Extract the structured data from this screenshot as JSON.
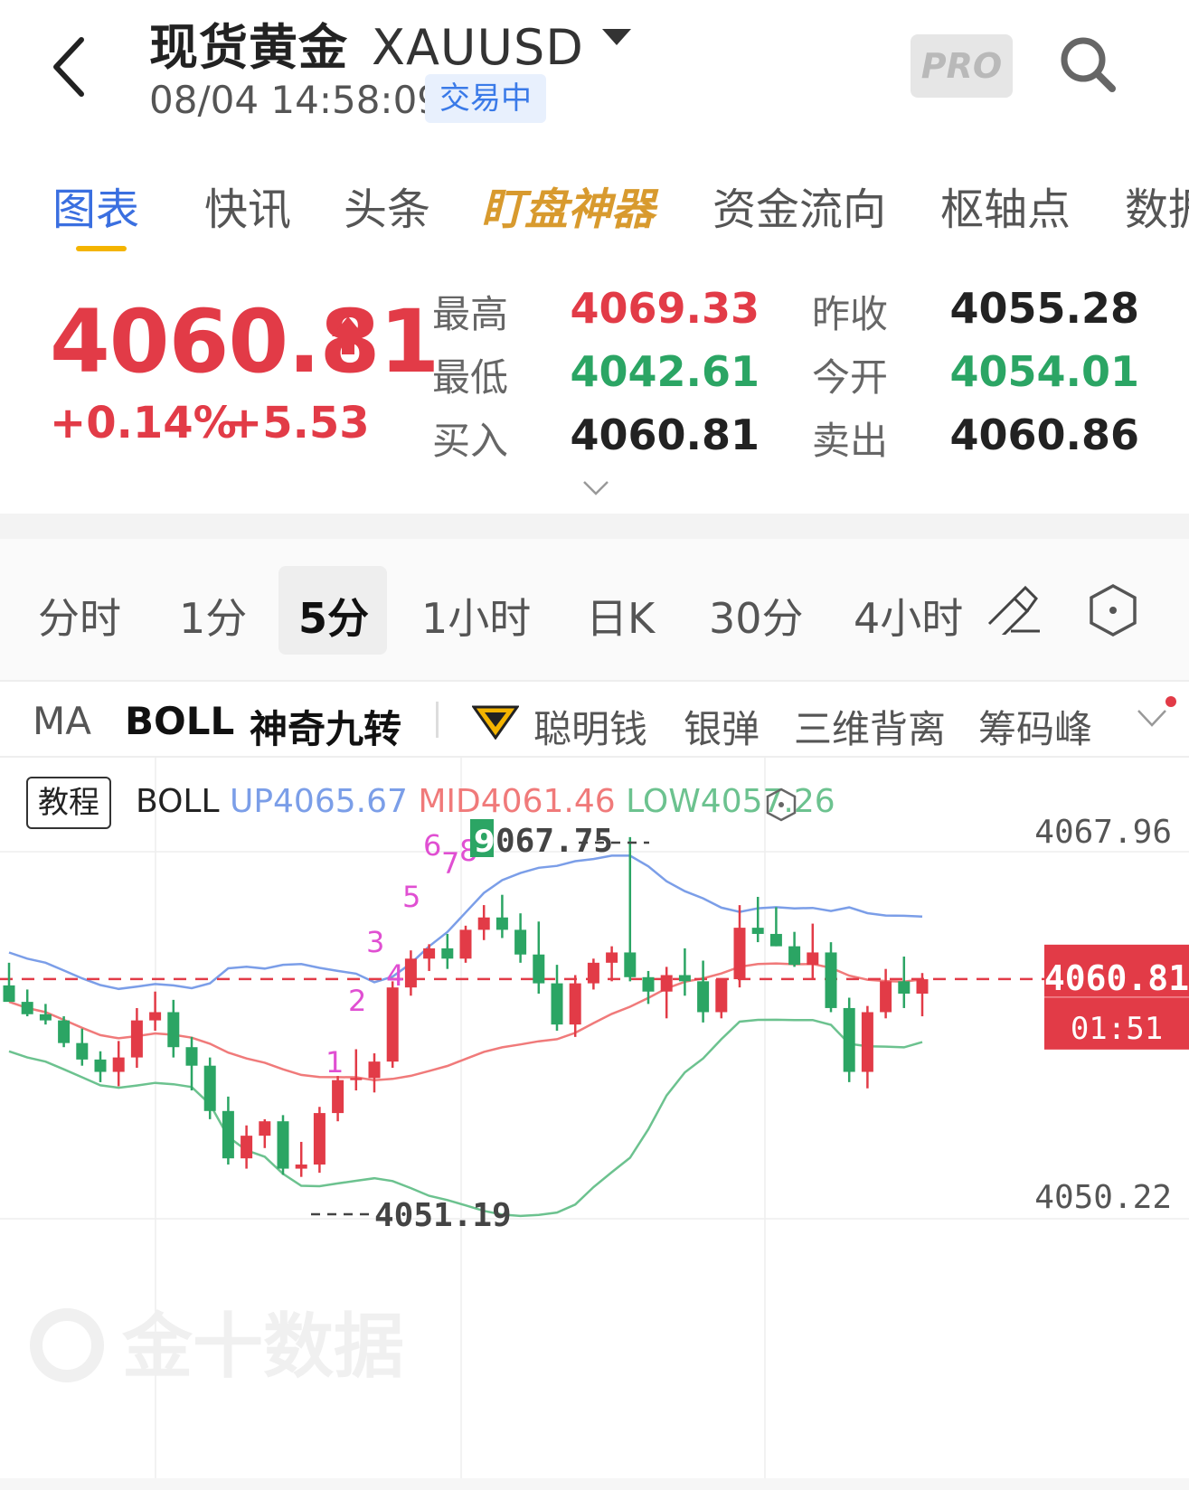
{
  "header": {
    "title": "现货黄金",
    "symbol": "XAUUSD",
    "datetime": "08/04 14:58:09",
    "status": "交易中",
    "pro_label": "PRO"
  },
  "main_tabs": [
    {
      "label": "图表"
    },
    {
      "label": "快讯"
    },
    {
      "label": "头条"
    },
    {
      "label": "盯盘神器"
    },
    {
      "label": "资金流向"
    },
    {
      "label": "枢轴点"
    },
    {
      "label": "数据"
    }
  ],
  "quote": {
    "price": "4060.81",
    "change_pct": "+0.14%",
    "change": "+5.53",
    "high_label": "最高",
    "high": "4069.33",
    "low_label": "最低",
    "low": "4042.61",
    "bid_label": "买入",
    "bid": "4060.81",
    "prev_close_label": "昨收",
    "prev_close": "4055.28",
    "open_label": "今开",
    "open": "4054.01",
    "ask_label": "卖出",
    "ask": "4060.86"
  },
  "period_tabs": [
    {
      "label": "分时"
    },
    {
      "label": "1分"
    },
    {
      "label": "5分"
    },
    {
      "label": "1小时"
    },
    {
      "label": "日K"
    },
    {
      "label": "30分"
    },
    {
      "label": "4小时"
    }
  ],
  "selected_period": "5分",
  "indicator_tabs": [
    {
      "label": "MA"
    },
    {
      "label": "BOLL"
    },
    {
      "label": "神奇九转"
    },
    {
      "label": "聪明钱"
    },
    {
      "label": "银弹"
    },
    {
      "label": "三维背离"
    },
    {
      "label": "筹码峰"
    }
  ],
  "chart_header": {
    "tutorial": "教程",
    "boll_name": "BOLL",
    "up": "UP4065.67",
    "mid": "MID4061.46",
    "low": "LOW4057.26"
  },
  "colors": {
    "up": "#e23b47",
    "down": "#2ba564",
    "boll_up": "#7b9ee8",
    "boll_mid": "#f07a7a",
    "boll_low": "#6cc28f",
    "accent": "#3a6fe0"
  },
  "chart_data": {
    "type": "candlestick",
    "axis_labels": [
      "4067.96",
      "4050.22"
    ],
    "current_price_tag": "4060.81",
    "countdown": "01:51",
    "high_marker": "4067.75",
    "high_marker_count": "9",
    "low_marker": "4051.19",
    "td_counts": [
      "1",
      "2",
      "3",
      "4",
      "5",
      "6",
      "7",
      "8"
    ],
    "watermark": "金十数据",
    "candles": [
      [
        4060.5,
        4061.6,
        4059.8,
        4059.7
      ],
      [
        4059.7,
        4060.3,
        4059.0,
        4059.1
      ],
      [
        4059.1,
        4059.6,
        4058.6,
        4058.8
      ],
      [
        4058.8,
        4059.0,
        4057.5,
        4057.7
      ],
      [
        4057.7,
        4058.4,
        4056.6,
        4056.9
      ],
      [
        4056.9,
        4057.3,
        4055.8,
        4056.3
      ],
      [
        4056.3,
        4057.8,
        4055.6,
        4057.0
      ],
      [
        4057.0,
        4059.4,
        4056.5,
        4058.8
      ],
      [
        4058.8,
        4060.2,
        4058.3,
        4059.2
      ],
      [
        4059.2,
        4059.8,
        4057.0,
        4057.5
      ],
      [
        4057.5,
        4058.0,
        4055.4,
        4056.6
      ],
      [
        4056.6,
        4057.0,
        4054.0,
        4054.4
      ],
      [
        4054.4,
        4055.1,
        4051.8,
        4052.1
      ],
      [
        4052.1,
        4053.7,
        4051.6,
        4053.2
      ],
      [
        4053.2,
        4054.0,
        4052.6,
        4053.9
      ],
      [
        4053.9,
        4054.2,
        4051.3,
        4051.6
      ],
      [
        4051.6,
        4052.9,
        4051.2,
        4051.8
      ],
      [
        4051.8,
        4054.6,
        4051.4,
        4054.3
      ],
      [
        4054.3,
        4056.1,
        4053.9,
        4055.9
      ],
      [
        4055.9,
        4057.4,
        4055.4,
        4056.0
      ],
      [
        4056.0,
        4057.2,
        4055.3,
        4056.8
      ],
      [
        4056.8,
        4060.7,
        4056.5,
        4060.4
      ],
      [
        4060.4,
        4062.2,
        4060.0,
        4061.8
      ],
      [
        4061.8,
        4062.5,
        4061.2,
        4062.3
      ],
      [
        4062.3,
        4063.0,
        4061.3,
        4061.8
      ],
      [
        4061.8,
        4063.4,
        4061.6,
        4063.2
      ],
      [
        4063.2,
        4064.4,
        4062.7,
        4063.8
      ],
      [
        4063.8,
        4064.9,
        4062.8,
        4063.2
      ],
      [
        4063.2,
        4064.0,
        4061.6,
        4062.0
      ],
      [
        4062.0,
        4063.6,
        4060.1,
        4060.6
      ],
      [
        4060.6,
        4061.5,
        4058.3,
        4058.6
      ],
      [
        4058.6,
        4061.0,
        4058.0,
        4060.6
      ],
      [
        4060.6,
        4061.8,
        4060.3,
        4061.6
      ],
      [
        4061.6,
        4062.4,
        4060.7,
        4062.1
      ],
      [
        4062.1,
        4067.7,
        4060.7,
        4060.9
      ],
      [
        4060.9,
        4061.2,
        4059.6,
        4060.2
      ],
      [
        4060.2,
        4061.4,
        4058.9,
        4061.0
      ],
      [
        4061.0,
        4062.3,
        4060.0,
        4060.7
      ],
      [
        4060.7,
        4061.7,
        4058.7,
        4059.2
      ],
      [
        4059.2,
        4060.3,
        4058.9,
        4060.8
      ],
      [
        4060.8,
        4064.4,
        4060.4,
        4063.3
      ],
      [
        4063.3,
        4064.8,
        4062.6,
        4063.0
      ],
      [
        4063.0,
        4064.3,
        4062.4,
        4062.4
      ],
      [
        4062.4,
        4063.1,
        4061.4,
        4061.5
      ],
      [
        4061.5,
        4063.5,
        4060.8,
        4062.1
      ],
      [
        4062.1,
        4062.6,
        4059.2,
        4059.4
      ],
      [
        4059.4,
        4059.9,
        4055.8,
        4056.3
      ],
      [
        4056.3,
        4059.5,
        4055.5,
        4059.2
      ],
      [
        4059.2,
        4061.3,
        4058.9,
        4060.7
      ],
      [
        4060.7,
        4061.9,
        4059.4,
        4060.1
      ],
      [
        4060.1,
        4061.1,
        4059.0,
        4060.8
      ]
    ]
  }
}
